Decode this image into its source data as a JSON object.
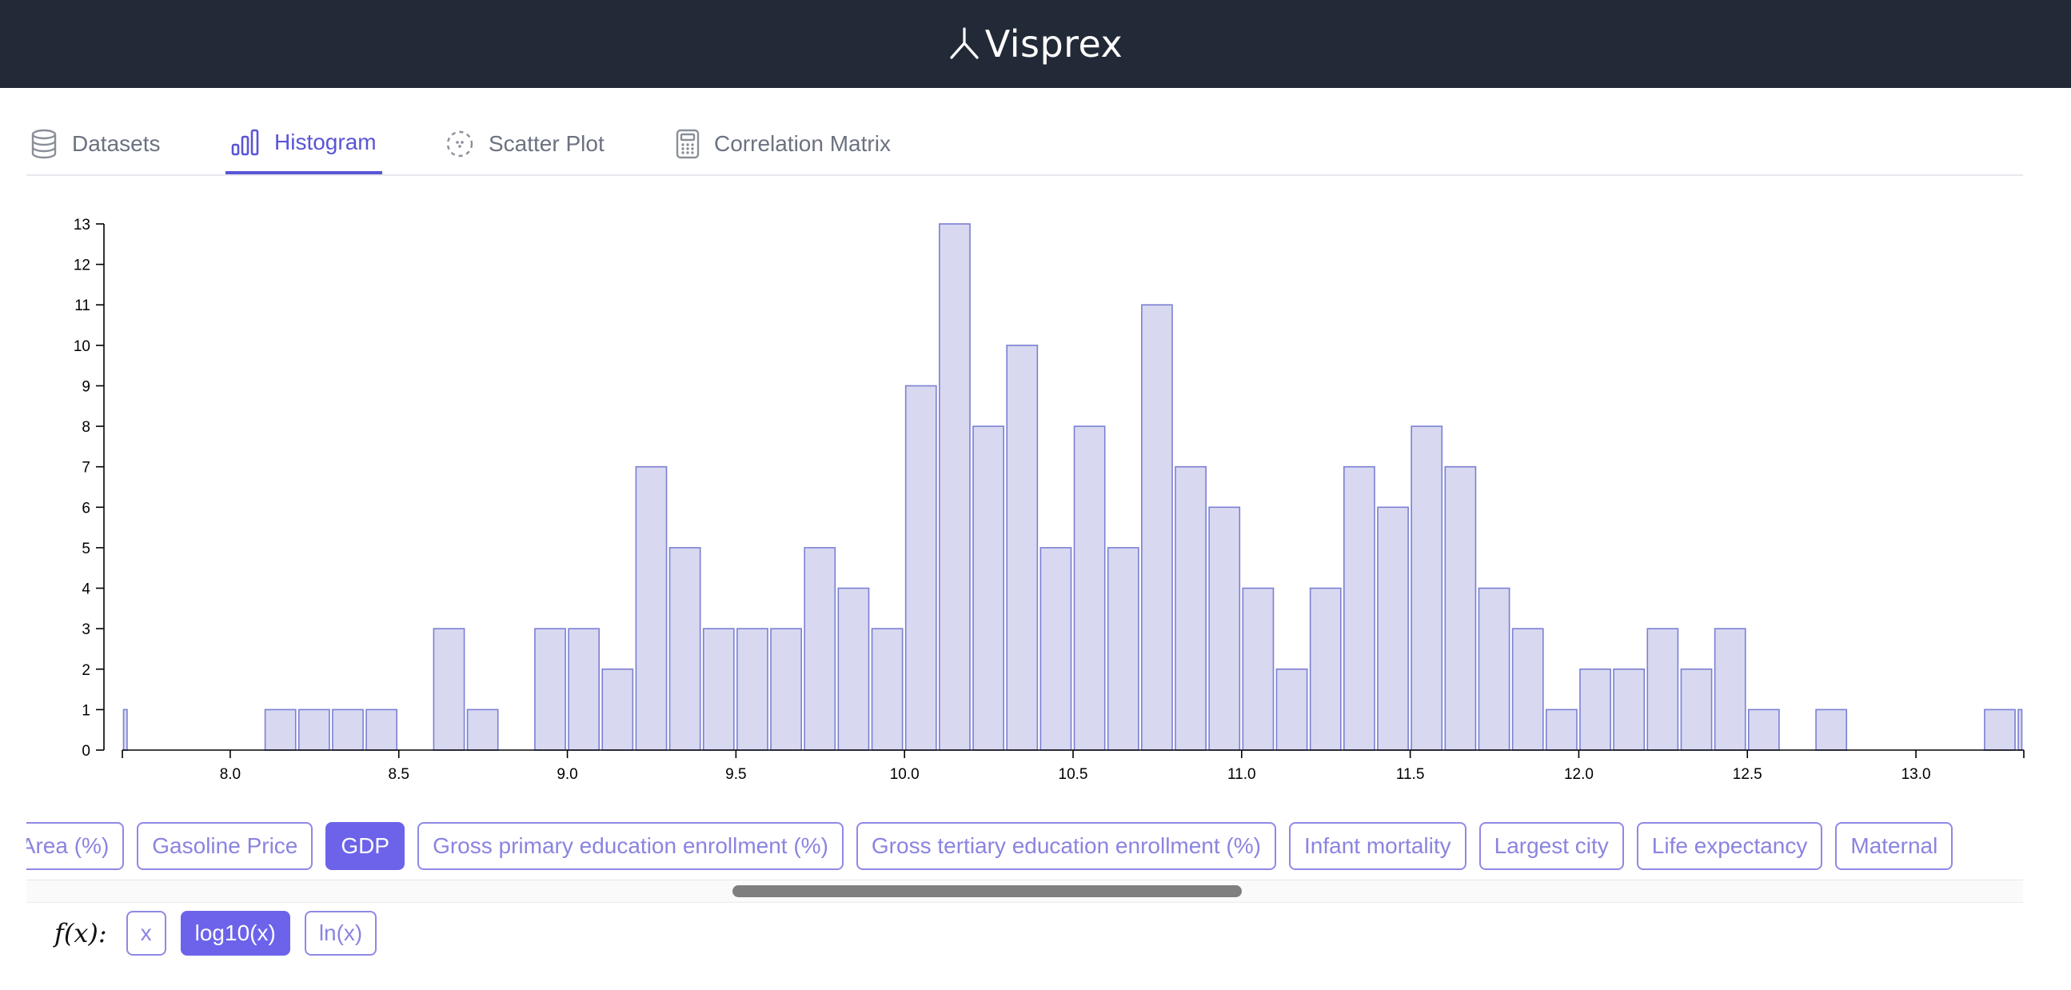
{
  "app": {
    "name": "Visprex"
  },
  "tabs": [
    {
      "label": "Datasets",
      "active": false
    },
    {
      "label": "Histogram",
      "active": true
    },
    {
      "label": "Scatter Plot",
      "active": false
    },
    {
      "label": "Correlation Matrix",
      "active": false
    }
  ],
  "chart_data": {
    "type": "bar",
    "bin_width": 0.1,
    "x_ticks": [
      8.0,
      8.5,
      9.0,
      9.5,
      10.0,
      10.5,
      11.0,
      11.5,
      12.0,
      12.5,
      13.0
    ],
    "y_ticks": [
      0,
      1,
      2,
      3,
      4,
      5,
      6,
      7,
      8,
      9,
      10,
      11,
      12,
      13
    ],
    "xlim": [
      7.68,
      13.32
    ],
    "ylim": [
      0,
      13
    ],
    "bins": [
      {
        "x0": 7.68,
        "x1": 7.7,
        "count": 1
      },
      {
        "x0": 8.1,
        "x1": 8.2,
        "count": 1
      },
      {
        "x0": 8.2,
        "x1": 8.3,
        "count": 1
      },
      {
        "x0": 8.3,
        "x1": 8.4,
        "count": 1
      },
      {
        "x0": 8.4,
        "x1": 8.5,
        "count": 1
      },
      {
        "x0": 8.6,
        "x1": 8.7,
        "count": 3
      },
      {
        "x0": 8.7,
        "x1": 8.8,
        "count": 1
      },
      {
        "x0": 8.9,
        "x1": 9.0,
        "count": 3
      },
      {
        "x0": 9.0,
        "x1": 9.1,
        "count": 3
      },
      {
        "x0": 9.1,
        "x1": 9.2,
        "count": 2
      },
      {
        "x0": 9.2,
        "x1": 9.3,
        "count": 7
      },
      {
        "x0": 9.3,
        "x1": 9.4,
        "count": 5
      },
      {
        "x0": 9.4,
        "x1": 9.5,
        "count": 3
      },
      {
        "x0": 9.5,
        "x1": 9.6,
        "count": 3
      },
      {
        "x0": 9.6,
        "x1": 9.7,
        "count": 3
      },
      {
        "x0": 9.7,
        "x1": 9.8,
        "count": 5
      },
      {
        "x0": 9.8,
        "x1": 9.9,
        "count": 4
      },
      {
        "x0": 9.9,
        "x1": 10.0,
        "count": 3
      },
      {
        "x0": 10.0,
        "x1": 10.1,
        "count": 9
      },
      {
        "x0": 10.1,
        "x1": 10.2,
        "count": 13
      },
      {
        "x0": 10.2,
        "x1": 10.3,
        "count": 8
      },
      {
        "x0": 10.3,
        "x1": 10.4,
        "count": 10
      },
      {
        "x0": 10.4,
        "x1": 10.5,
        "count": 5
      },
      {
        "x0": 10.5,
        "x1": 10.6,
        "count": 8
      },
      {
        "x0": 10.6,
        "x1": 10.7,
        "count": 5
      },
      {
        "x0": 10.7,
        "x1": 10.8,
        "count": 11
      },
      {
        "x0": 10.8,
        "x1": 10.9,
        "count": 7
      },
      {
        "x0": 10.9,
        "x1": 11.0,
        "count": 6
      },
      {
        "x0": 11.0,
        "x1": 11.1,
        "count": 4
      },
      {
        "x0": 11.1,
        "x1": 11.2,
        "count": 2
      },
      {
        "x0": 11.2,
        "x1": 11.3,
        "count": 4
      },
      {
        "x0": 11.3,
        "x1": 11.4,
        "count": 7
      },
      {
        "x0": 11.4,
        "x1": 11.5,
        "count": 6
      },
      {
        "x0": 11.5,
        "x1": 11.6,
        "count": 8
      },
      {
        "x0": 11.6,
        "x1": 11.7,
        "count": 7
      },
      {
        "x0": 11.7,
        "x1": 11.8,
        "count": 4
      },
      {
        "x0": 11.8,
        "x1": 11.9,
        "count": 3
      },
      {
        "x0": 11.9,
        "x1": 12.0,
        "count": 1
      },
      {
        "x0": 12.0,
        "x1": 12.1,
        "count": 2
      },
      {
        "x0": 12.1,
        "x1": 12.2,
        "count": 2
      },
      {
        "x0": 12.2,
        "x1": 12.3,
        "count": 3
      },
      {
        "x0": 12.3,
        "x1": 12.4,
        "count": 2
      },
      {
        "x0": 12.4,
        "x1": 12.5,
        "count": 3
      },
      {
        "x0": 12.5,
        "x1": 12.6,
        "count": 1
      },
      {
        "x0": 12.7,
        "x1": 12.8,
        "count": 1
      },
      {
        "x0": 13.2,
        "x1": 13.3,
        "count": 1
      },
      {
        "x0": 13.3,
        "x1": 13.32,
        "count": 1
      }
    ],
    "colors": {
      "bar_fill": "#d8d9f0",
      "bar_stroke": "#7b7fd4",
      "axis": "#000000"
    },
    "grid": false,
    "legend": "none"
  },
  "variables": {
    "items": [
      "d Area (%)",
      "Gasoline Price",
      "GDP",
      "Gross primary education enrollment (%)",
      "Gross tertiary education enrollment (%)",
      "Infant mortality",
      "Largest city",
      "Life expectancy",
      "Maternal"
    ],
    "selected": "GDP"
  },
  "transform": {
    "label": "f(x):",
    "options": [
      "x",
      "log10(x)",
      "ln(x)"
    ],
    "selected": "log10(x)"
  },
  "colors": {
    "accent": "#5a55d6",
    "chip_active": "#6c63ea",
    "header_bg": "#232a37"
  }
}
